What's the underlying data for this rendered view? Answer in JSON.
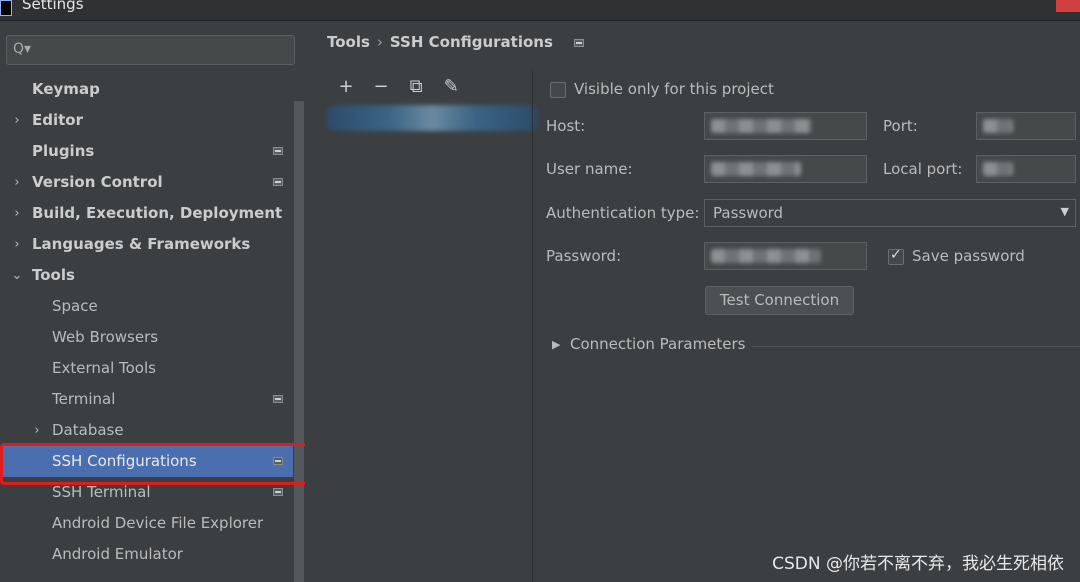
{
  "window": {
    "title": "Settings"
  },
  "sidebar": {
    "search_placeholder": "Q▾",
    "items": [
      {
        "label": "Keymap"
      },
      {
        "label": "Editor"
      },
      {
        "label": "Plugins"
      },
      {
        "label": "Version Control"
      },
      {
        "label": "Build, Execution, Deployment"
      },
      {
        "label": "Languages & Frameworks"
      },
      {
        "label": "Tools"
      },
      {
        "label": "Space"
      },
      {
        "label": "Web Browsers"
      },
      {
        "label": "External Tools"
      },
      {
        "label": "Terminal"
      },
      {
        "label": "Database"
      },
      {
        "label": "SSH Configurations"
      },
      {
        "label": "SSH Terminal"
      },
      {
        "label": "Android Device File Explorer"
      },
      {
        "label": "Android Emulator"
      }
    ]
  },
  "breadcrumb": {
    "parent": "Tools",
    "separator": "›",
    "current": "SSH Configurations"
  },
  "toolbar": {
    "add": "+",
    "remove": "−",
    "copy": "⧉",
    "edit": "✎"
  },
  "form": {
    "visible_only_label": "Visible only for this project",
    "host_label": "Host:",
    "port_label": "Port:",
    "username_label": "User name:",
    "local_port_label": "Local port:",
    "auth_type_label": "Authentication type:",
    "auth_type_value": "Password",
    "password_label": "Password:",
    "save_password_label": "Save password",
    "test_connection_label": "Test Connection",
    "connection_params_label": "Connection Parameters"
  },
  "watermark": "CSDN @你若不离不弃，我必生死相依"
}
